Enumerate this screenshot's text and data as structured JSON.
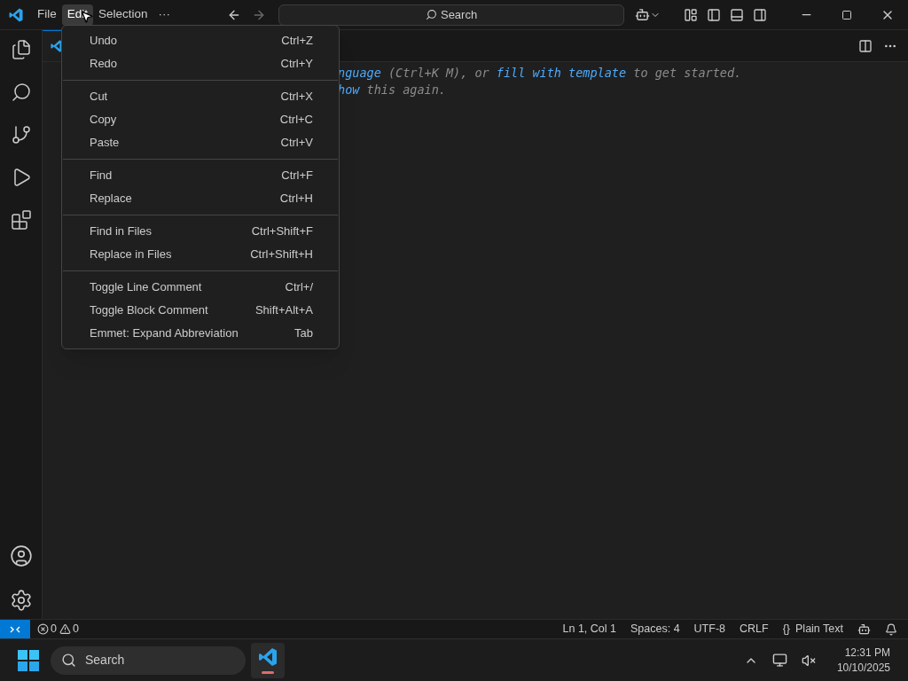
{
  "menubar": [
    {
      "label": "File",
      "selected": false
    },
    {
      "label": "Edit",
      "selected": true
    },
    {
      "label": "Selection",
      "selected": false
    },
    {
      "label": "···",
      "selected": false
    }
  ],
  "command_center": {
    "placeholder": "Search"
  },
  "editor": {
    "hint_lines": [
      [
        {
          "kind": "link",
          "text": "nguage"
        },
        {
          "kind": "text",
          "text": " (Ctrl+K M), or "
        },
        {
          "kind": "link",
          "text": "fill with template"
        },
        {
          "kind": "text",
          "text": " to get started."
        }
      ],
      [
        {
          "kind": "link",
          "text": "how"
        },
        {
          "kind": "text",
          "text": " this again."
        }
      ]
    ]
  },
  "edit_menu": {
    "groups": [
      [
        {
          "label": "Undo",
          "shortcut": "Ctrl+Z"
        },
        {
          "label": "Redo",
          "shortcut": "Ctrl+Y"
        }
      ],
      [
        {
          "label": "Cut",
          "shortcut": "Ctrl+X"
        },
        {
          "label": "Copy",
          "shortcut": "Ctrl+C"
        },
        {
          "label": "Paste",
          "shortcut": "Ctrl+V"
        }
      ],
      [
        {
          "label": "Find",
          "shortcut": "Ctrl+F"
        },
        {
          "label": "Replace",
          "shortcut": "Ctrl+H"
        }
      ],
      [
        {
          "label": "Find in Files",
          "shortcut": "Ctrl+Shift+F"
        },
        {
          "label": "Replace in Files",
          "shortcut": "Ctrl+Shift+H"
        }
      ],
      [
        {
          "label": "Toggle Line Comment",
          "shortcut": "Ctrl+/"
        },
        {
          "label": "Toggle Block Comment",
          "shortcut": "Shift+Alt+A"
        },
        {
          "label": "Emmet: Expand Abbreviation",
          "shortcut": "Tab"
        }
      ]
    ]
  },
  "status_bar": {
    "problems": [
      {
        "kind": "error",
        "count": "0"
      },
      {
        "kind": "warning",
        "count": "0"
      }
    ],
    "items": [
      "Ln 1, Col 1",
      "Spaces: 4",
      "UTF-8",
      "CRLF",
      "Plain Text"
    ],
    "language_braces": "{}"
  },
  "taskbar": {
    "search": {
      "placeholder": "Search"
    },
    "time": "12:31 PM",
    "date": "10/10/2025"
  }
}
